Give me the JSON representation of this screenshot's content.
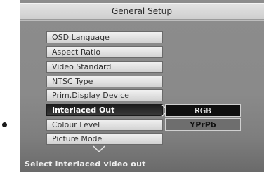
{
  "header": {
    "title": "General Setup"
  },
  "menu": {
    "items": [
      {
        "label": "OSD Language"
      },
      {
        "label": "Aspect Ratio"
      },
      {
        "label": "Video Standard"
      },
      {
        "label": "NTSC Type"
      },
      {
        "label": "Prim.Display Device"
      },
      {
        "label": "Interlaced Out",
        "selected": true
      },
      {
        "label": "Colour Level"
      },
      {
        "label": "Picture Mode"
      }
    ]
  },
  "submenu": {
    "options": [
      {
        "label": "RGB"
      },
      {
        "label": "YPrPb",
        "selected": true
      }
    ]
  },
  "status": {
    "text": "Select interlaced video out"
  },
  "icons": {
    "submenu_arrow": "chevron-right-icon",
    "scroll": "chevron-down-icon"
  },
  "colors": {
    "selection_dark": "#1c1c1c",
    "panel_gray": "#8a8a8a"
  }
}
